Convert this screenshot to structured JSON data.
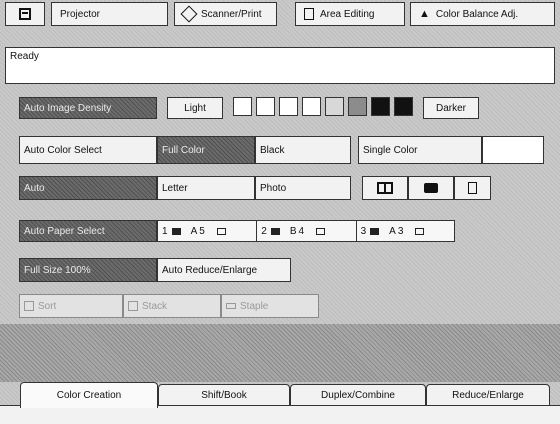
{
  "top_tabs": [
    {
      "label": "Projector",
      "icon": "projector-icon"
    },
    {
      "label": "Scanner/Print",
      "icon": "scanner-icon"
    },
    {
      "label": "Area Editing",
      "icon": "area-editing-icon"
    },
    {
      "label": "Color Balance Adj.",
      "icon": "color-balance-icon"
    }
  ],
  "status_message": "Ready",
  "density": {
    "auto_label": "Auto Image Density",
    "light_label": "Light",
    "darker_label": "Darker",
    "swatches": [
      "#ffffff",
      "#ffffff",
      "#ffffff",
      "#ffffff",
      "#d8d8d8",
      "#8c8c8c",
      "#111111",
      "#111111"
    ]
  },
  "color_mode": {
    "auto_label": "Auto Color Select",
    "full_label": "Full Color",
    "black_label": "Black",
    "single_label": "Single Color"
  },
  "original_type": {
    "auto_label": "Auto",
    "letter_label": "Letter",
    "photo_label": "Photo",
    "icons": [
      "book-icon",
      "photo-camera-icon",
      "document-icon"
    ]
  },
  "paper": {
    "auto_label": "Auto Paper Select",
    "trays": [
      {
        "number": "1",
        "size": "A5"
      },
      {
        "number": "2",
        "size": "B4"
      },
      {
        "number": "3",
        "size": "A3"
      }
    ]
  },
  "reduce_enlarge": {
    "full_size_label": "Full Size 100%",
    "auto_label": "Auto Reduce/Enlarge"
  },
  "finishing": {
    "sort_label": "Sort",
    "stack_label": "Stack",
    "staple_label": "Staple"
  },
  "bottom_tabs": [
    {
      "label": "Color Creation"
    },
    {
      "label": "Shift/Book"
    },
    {
      "label": "Duplex/Combine"
    },
    {
      "label": "Reduce/Enlarge"
    }
  ]
}
